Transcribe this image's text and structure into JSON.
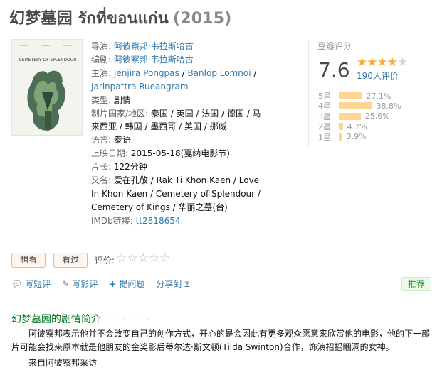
{
  "title": {
    "main": "幻梦墓园 รักที่ขอนแก่น",
    "year": "(2015)"
  },
  "poster": {
    "alt_text": "CEMETERY OF SPLENDOUR"
  },
  "info": {
    "director": {
      "label": "导演:",
      "value": "阿彼察邦·韦拉斯哈古"
    },
    "writer": {
      "label": "编剧:",
      "value": "阿彼察邦·韦拉斯哈古"
    },
    "cast": {
      "label": "主演:",
      "names": [
        "Jenjira Pongpas",
        "Banlop Lomnoi",
        "Jarinpattra Rueangram"
      ]
    },
    "genre": {
      "label": "类型:",
      "value": "剧情"
    },
    "country": {
      "label": "制片国家/地区:",
      "value": "泰国 / 英国 / 法国 / 德国 / 马来西亚 / 韩国 / 墨西哥 / 美国 / 挪威"
    },
    "language": {
      "label": "语言:",
      "value": "泰语"
    },
    "release": {
      "label": "上映日期:",
      "value": "2015-05-18(戛纳电影节)"
    },
    "runtime": {
      "label": "片长:",
      "value": "122分钟"
    },
    "aka": {
      "label": "又名:",
      "value": "爱在孔敬 / Rak Ti Khon Kaen / Love In Khon Kaen / Cemetery of Splendour / Cemetery of Kings / 华丽之墓(台)"
    },
    "imdb": {
      "label": "IMDb链接:",
      "value": "tt2818654"
    }
  },
  "rating": {
    "label": "豆瓣评分",
    "score": "7.6",
    "stars_filled": 4,
    "stars_total": 5,
    "votes": "190人评价",
    "distribution": [
      {
        "star": "5星",
        "pct": "27.1%",
        "value": 27.1
      },
      {
        "star": "4星",
        "pct": "38.8%",
        "value": 38.8
      },
      {
        "star": "3星",
        "pct": "25.6%",
        "value": 25.6
      },
      {
        "star": "2星",
        "pct": "4.7%",
        "value": 4.7
      },
      {
        "star": "1星",
        "pct": "3.9%",
        "value": 3.9
      }
    ],
    "bar_color": "#ffd596"
  },
  "actions": {
    "want": "想看",
    "seen": "看过",
    "rate_label": "评价:",
    "user_stars_total": 5
  },
  "tools": {
    "short_review": "写短评",
    "review": "写影评",
    "question": "提问题",
    "share": "分享到",
    "recommend": "推荐"
  },
  "summary": {
    "heading": "幻梦墓园的剧情简介",
    "dots": "· · · · · ·",
    "text": "阿彼察邦表示他并不会改变自己的创作方式，开心的是会因此有更多观众愿意来欣赏他的电影，他的下一部片可能会找来原本就是他朋友的金奖影后蒂尔达·斯文顿(Tilda Swinton)合作，饰演招摇睏洞的女神。",
    "source": "来自阿彼察邦采访"
  }
}
